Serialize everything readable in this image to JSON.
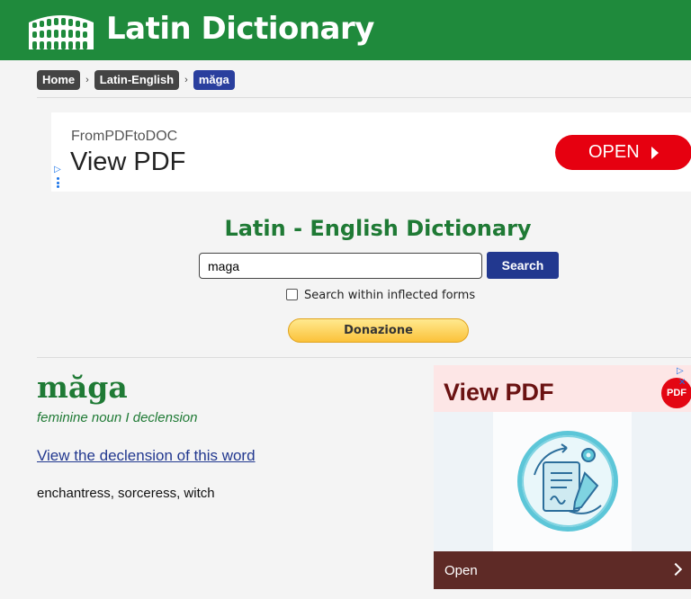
{
  "header": {
    "site_title": "Latin Dictionary",
    "logo_icon": "colosseum-icon",
    "background": "#1f8a3c"
  },
  "breadcrumb": {
    "items": [
      "Home",
      "Latin-English",
      "măga"
    ],
    "separator": "›"
  },
  "ad_top": {
    "brand": "FromPDFtoDOC",
    "headline": "View PDF",
    "button_label": "OPEN",
    "ad_choices_mark": "▷"
  },
  "search": {
    "title": "Latin - English Dictionary",
    "query": "maga",
    "button_label": "Search",
    "checkbox_label": "Search within inflected forms",
    "checkbox_checked": false,
    "donate_label": "Donazione"
  },
  "entry": {
    "headword": "măga",
    "grammar": "feminine noun I declension",
    "declension_link": "View the declension of this word",
    "meaning": "enchantress, sorceress, witch"
  },
  "ad_side": {
    "headline": "View PDF",
    "badge": "PDF",
    "footer_label": "Open",
    "ad_choices_mark": "▷",
    "close_mark": "✕"
  }
}
